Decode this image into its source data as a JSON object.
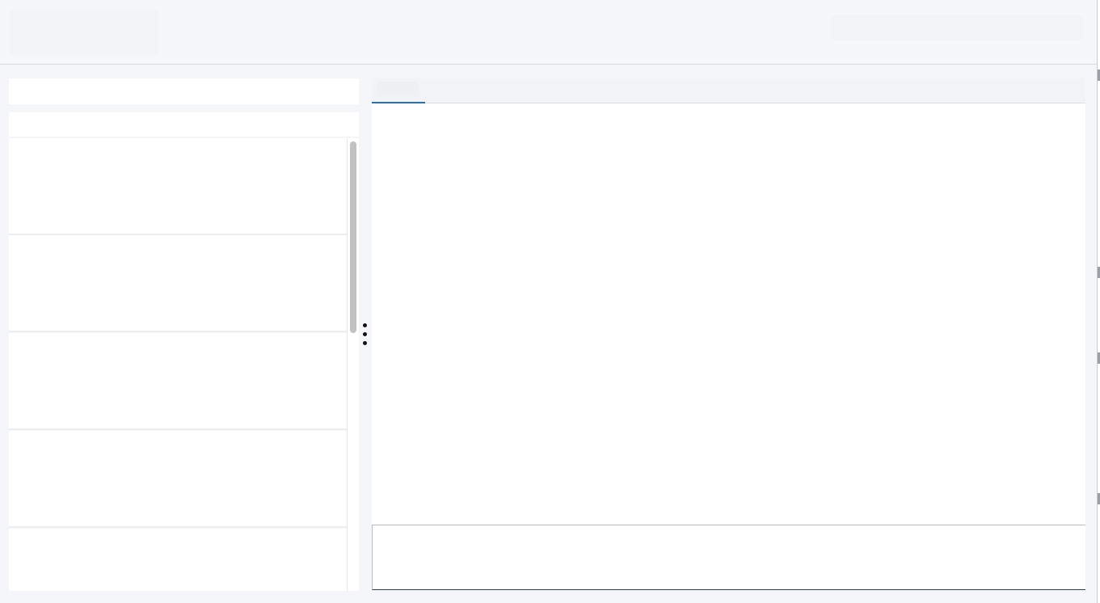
{
  "header": {
    "logo_label": "",
    "search_placeholder": ""
  },
  "sidebar": {
    "search_placeholder": "",
    "filter_label": "",
    "items": [
      {
        "title": ""
      },
      {
        "title": ""
      },
      {
        "title": ""
      },
      {
        "title": ""
      },
      {
        "title": ""
      }
    ]
  },
  "main": {
    "tabs": [
      {
        "label": "",
        "active": true
      }
    ],
    "content_text": "",
    "composer_placeholder": ""
  },
  "colors": {
    "accent": "#2f6fa8",
    "background": "#f5f6f9",
    "panel": "#ffffff"
  },
  "icons": {
    "splitter": "vertical-ellipsis-icon"
  }
}
